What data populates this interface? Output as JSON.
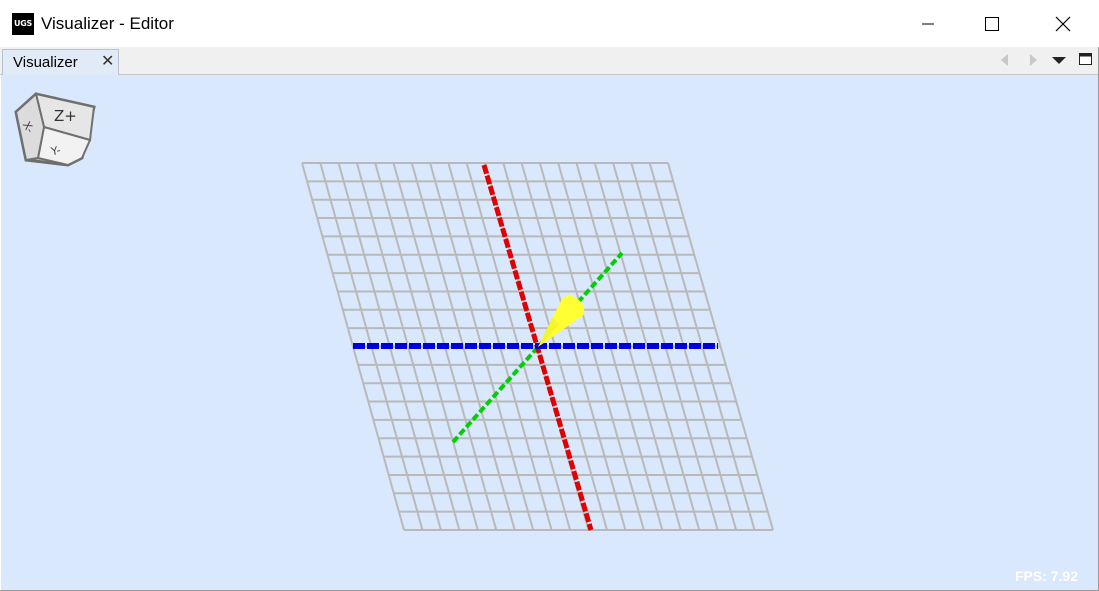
{
  "window": {
    "title": "Visualizer - Editor",
    "app_icon_text": "UGS",
    "controls": [
      "minimize-icon",
      "maximize-icon",
      "close-icon"
    ]
  },
  "tab": {
    "label": "Visualizer",
    "close_glyph": "✕"
  },
  "tab_toolbar": [
    "arrow-left-icon",
    "arrow-right-icon",
    "dropdown-icon",
    "maximize-panel-icon"
  ],
  "view_cube": {
    "top_label": "Z+",
    "front_label": "Y-",
    "left_label": "X-"
  },
  "status": {
    "fps": "FPS: 7.92"
  },
  "colors": {
    "background": "#d9e8fc",
    "grid": "#b9b9b9",
    "x_axis": "#e00000",
    "y_axis": "#00d000",
    "z_axis": "#0000d8",
    "tool": "#ffff33"
  }
}
